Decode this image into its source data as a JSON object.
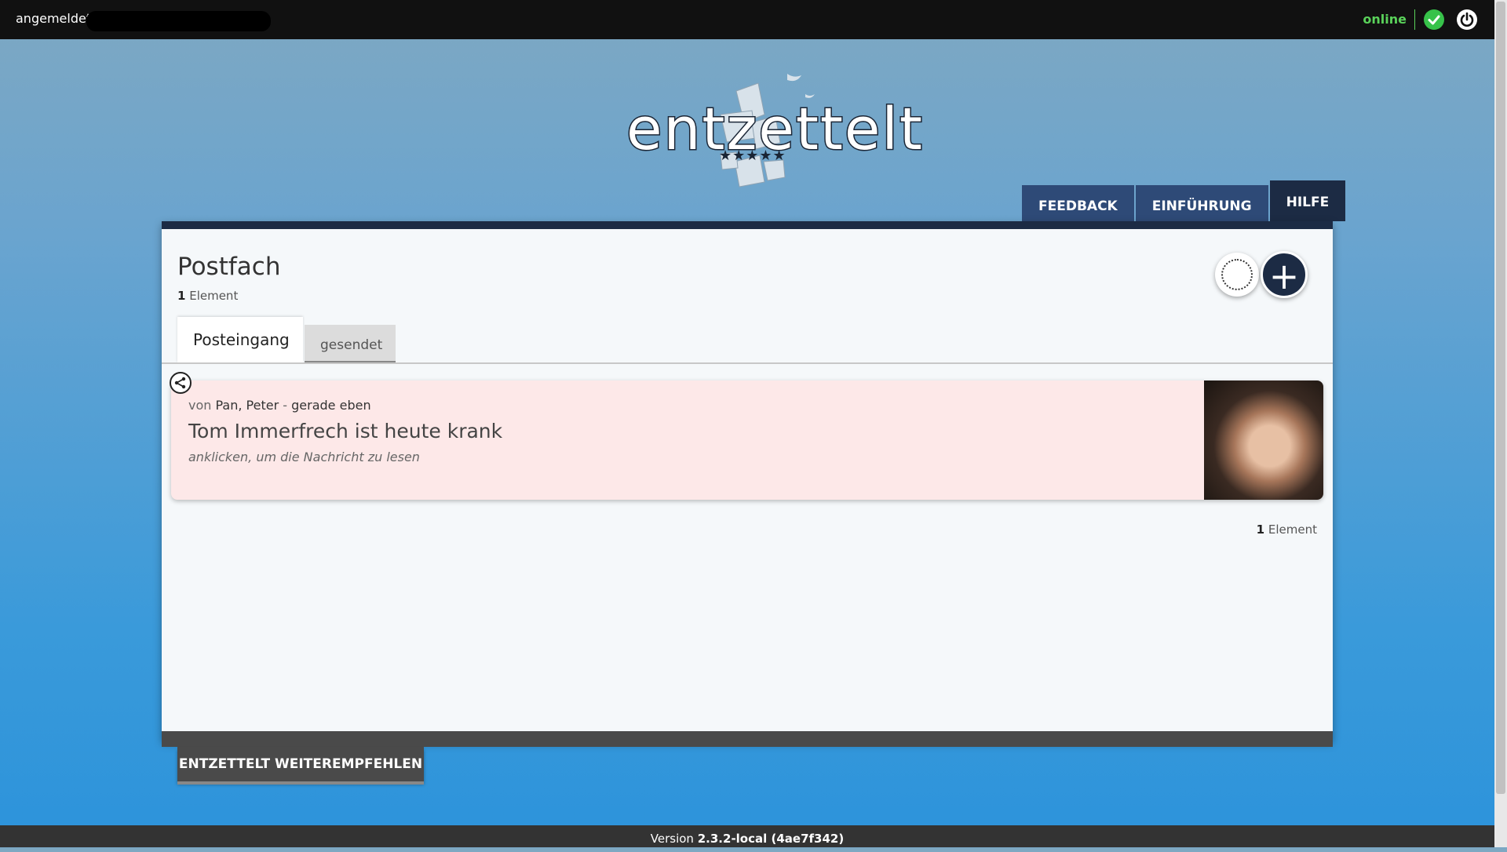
{
  "topbar": {
    "status_left": "angemeldet",
    "status_right": "online",
    "icons": [
      "check-circle-icon",
      "power-icon"
    ],
    "colors": {
      "online": "#5ad25a",
      "check": "#37c24a"
    }
  },
  "logo": {
    "text": "entzettelt",
    "stars": "★★★★★"
  },
  "nav": {
    "tabs": [
      {
        "label": "FEEDBACK",
        "active": false
      },
      {
        "label": "EINFÜHRUNG",
        "active": false
      },
      {
        "label": "HILFE",
        "active": true
      }
    ]
  },
  "panel": {
    "title": "Postfach",
    "count_number": "1",
    "count_label": "Element",
    "tabs": [
      {
        "label": "Posteingang",
        "active": true
      },
      {
        "label": "gesendet",
        "active": false
      }
    ],
    "buttons": [
      "empty-circle",
      "plus"
    ]
  },
  "message": {
    "from_prefix": "von",
    "from_name": "Pan, Peter",
    "separator": "-",
    "time": "gerade eben",
    "title": "Tom Immerfrech ist heute krank",
    "subtitle": "anklicken, um die Nachricht zu lesen"
  },
  "footer_count": {
    "number": "1",
    "label": "Element"
  },
  "recommend_label": "ENTZETTELT WEITEREMPFEHLEN",
  "version": {
    "prefix": "Version",
    "value": "2.3.2-local (4ae7f342)"
  }
}
